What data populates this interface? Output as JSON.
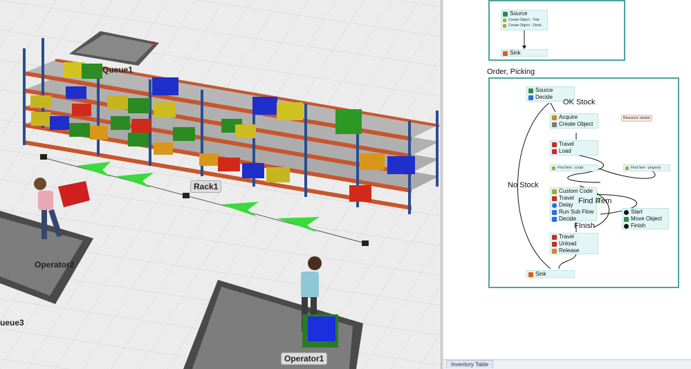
{
  "viewport3d": {
    "labels": {
      "queue1": "Queue1",
      "rack1": "Rack1",
      "operator1": "Operator1",
      "operator2": "Operator2",
      "queue3": "ueue3"
    }
  },
  "process_flow": {
    "group_top": {
      "source": "Source",
      "create1": "Create Object - Tote",
      "create2": "Create Object - Stock",
      "sink": "Sink"
    },
    "group_main": {
      "title": "Order, Picking",
      "source": "Source",
      "decide": "Decide",
      "acquire": "Acquire",
      "create_object": "Create Object",
      "travel1": "Travel",
      "load": "Load",
      "find_item_script": "Find Item : script",
      "find_item_property": "Find Item : property",
      "resource": "Resource: worker",
      "custom_code": "Custom Code",
      "travel2": "Travel",
      "delay": "Delay",
      "run_sub_flow": "Run Sub Flow",
      "decide2": "Decide",
      "start": "Start",
      "move_object": "Move Object",
      "finish": "Finish",
      "travel3": "Travel",
      "unload": "Unload",
      "release": "Release",
      "sink": "Sink",
      "label_ok_stock": "OK Stock",
      "label_no_stock": "No Stock",
      "label_find_item": "Find ITem",
      "label_finish": "FInish"
    },
    "bottom_tab": "Inventory Table"
  }
}
